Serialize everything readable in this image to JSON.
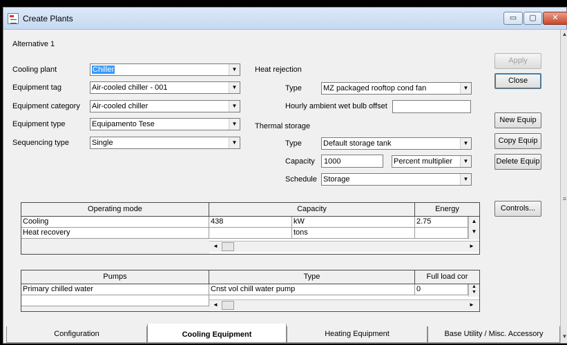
{
  "window": {
    "title": "Create Plants",
    "min_glyph": "▭",
    "max_glyph": "▢",
    "close_glyph": "✕"
  },
  "alternative_label": "Alternative 1",
  "left_form": {
    "cooling_plant": {
      "label": "Cooling plant",
      "value": "Chiller"
    },
    "equipment_tag": {
      "label": "Equipment tag",
      "value": "Air-cooled chiller - 001"
    },
    "equipment_category": {
      "label": "Equipment category",
      "value": "Air-cooled chiller"
    },
    "equipment_type": {
      "label": "Equipment type",
      "value": "Equipamento Tese"
    },
    "sequencing_type": {
      "label": "Sequencing type",
      "value": "Single"
    }
  },
  "heat_rejection": {
    "heading": "Heat rejection",
    "type_label": "Type",
    "type_value": "MZ packaged rooftop cond fan",
    "offset_label": "Hourly ambient wet bulb offset",
    "offset_value": ""
  },
  "thermal_storage": {
    "heading": "Thermal storage",
    "type_label": "Type",
    "type_value": "Default storage tank",
    "capacity_label": "Capacity",
    "capacity_value": "1000",
    "capacity_unit": "Percent multiplier",
    "schedule_label": "Schedule",
    "schedule_value": "Storage"
  },
  "buttons": {
    "apply": "Apply",
    "close": "Close",
    "new_equip": "New Equip",
    "copy_equip": "Copy Equip",
    "delete_equip": "Delete Equip",
    "controls": "Controls..."
  },
  "operating_grid": {
    "headers": [
      "Operating mode",
      "Capacity",
      "Energy"
    ],
    "rows": [
      {
        "mode": "Cooling",
        "capacity": "438",
        "unit": "kW",
        "energy": "2.75"
      },
      {
        "mode": "Heat recovery",
        "capacity": "",
        "unit": "tons",
        "energy": ""
      }
    ]
  },
  "pumps_grid": {
    "headers": [
      "Pumps",
      "Type",
      "Full load cor"
    ],
    "rows": [
      {
        "pump": "Primary chilled water",
        "type": "Cnst vol chill water pump",
        "full_load": "0"
      },
      {
        "pump": "",
        "type": "",
        "full_load": ""
      }
    ]
  },
  "tabs": [
    {
      "label": "Configuration",
      "active": false
    },
    {
      "label": "Cooling Equipment",
      "active": true
    },
    {
      "label": "Heating Equipment",
      "active": false
    },
    {
      "label": "Base Utility / Misc. Accessory",
      "active": false
    }
  ],
  "glyphs": {
    "down": "▼",
    "up": "▲",
    "left": "◄",
    "right": "►",
    "grip": "≡"
  }
}
